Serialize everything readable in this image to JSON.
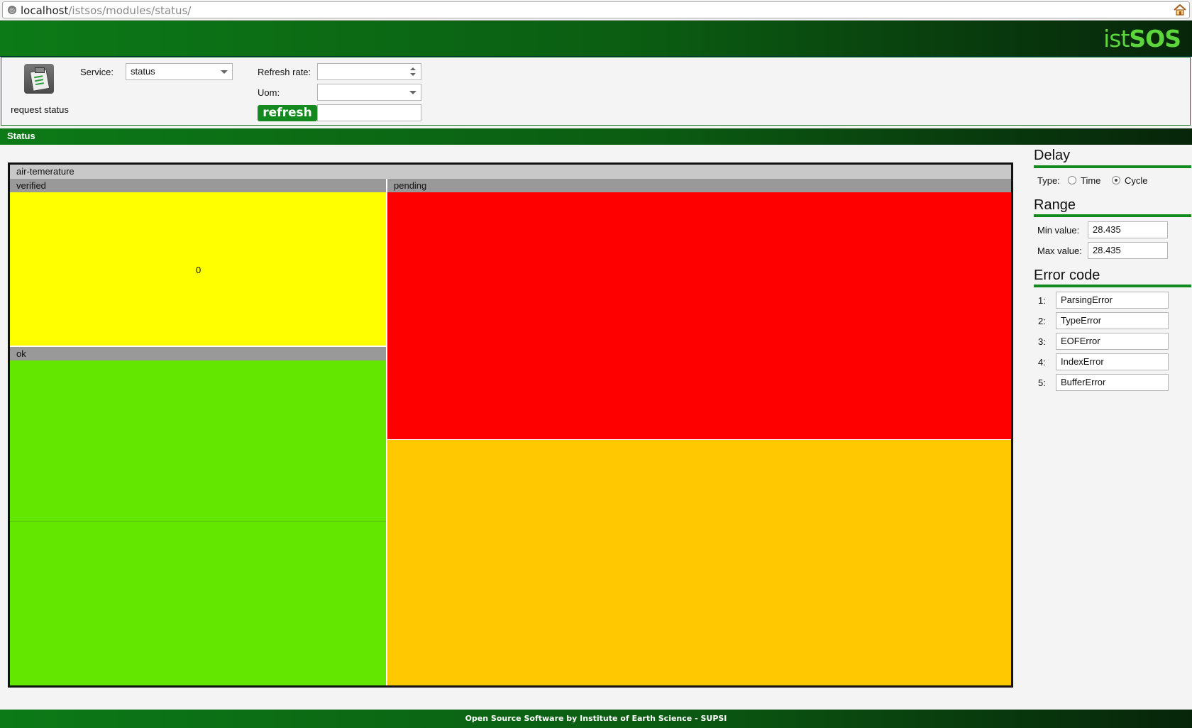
{
  "browser": {
    "url_host": "localhost",
    "url_path": "/istsos/modules/status/"
  },
  "header": {
    "logo_ist": "ist",
    "logo_sos": "SOS"
  },
  "toolbar": {
    "request_status_label": "request status",
    "service_label": "Service:",
    "service_value": "status",
    "refresh_rate_label": "Refresh rate:",
    "refresh_rate_value": "",
    "uom_label": "Uom:",
    "uom_value": "",
    "refresh_button": "refresh"
  },
  "status_bar": {
    "title": "Status"
  },
  "treemap": {
    "title": "air-temerature",
    "groups": [
      {
        "label": "verified",
        "value": "0",
        "color": "#ffff00"
      },
      {
        "label": "ok",
        "color": "#63e600"
      },
      {
        "label": "pending",
        "color": "#ff0000"
      }
    ],
    "lower_right_color": "#ffc800"
  },
  "panel": {
    "delay": {
      "title": "Delay",
      "type_label": "Type:",
      "options": [
        {
          "label": "Time",
          "selected": false
        },
        {
          "label": "Cycle",
          "selected": true
        }
      ]
    },
    "range": {
      "title": "Range",
      "min_label": "Min value:",
      "min_value": "28.435",
      "max_label": "Max value:",
      "max_value": "28.435"
    },
    "error_code": {
      "title": "Error code",
      "items": [
        {
          "num": "1:",
          "value": "ParsingError"
        },
        {
          "num": "2:",
          "value": "TypeError"
        },
        {
          "num": "3:",
          "value": "EOFError"
        },
        {
          "num": "4:",
          "value": "IndexError"
        },
        {
          "num": "5:",
          "value": "BufferError"
        }
      ]
    }
  },
  "footer": {
    "text": "Open Source Software by Institute of Earth Science - SUPSI"
  },
  "colors": {
    "brand_green": "#14891f",
    "accent_line": "#138a1e"
  }
}
